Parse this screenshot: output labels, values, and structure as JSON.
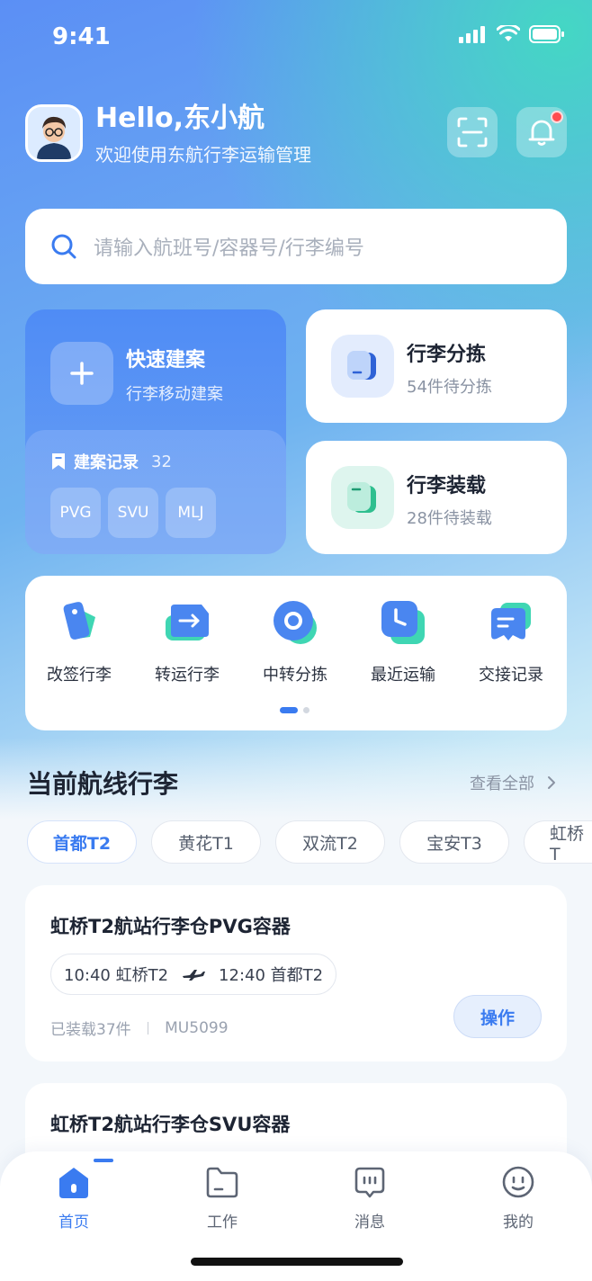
{
  "status_bar": {
    "time": "9:41"
  },
  "header": {
    "greeting": "Hello,东小航",
    "subtitle": "欢迎使用东航行李运输管理"
  },
  "search": {
    "placeholder": "请输入航班号/容器号/行李编号"
  },
  "quick_build": {
    "title": "快速建案",
    "subtitle": "行李移动建案",
    "records_label": "建案记录",
    "records_count": "32",
    "tags": [
      "PVG",
      "SVU",
      "MLJ"
    ]
  },
  "sorting_card": {
    "title": "行李分拣",
    "subtitle": "54件待分拣"
  },
  "loading_card": {
    "title": "行李装载",
    "subtitle": "28件待装载"
  },
  "shortcuts": [
    {
      "label": "改签行李",
      "icon": "tag-icon"
    },
    {
      "label": "转运行李",
      "icon": "transfer-icon"
    },
    {
      "label": "中转分拣",
      "icon": "transit-sort-icon"
    },
    {
      "label": "最近运输",
      "icon": "clock-icon"
    },
    {
      "label": "交接记录",
      "icon": "handover-icon"
    }
  ],
  "routes_section": {
    "title": "当前航线行李",
    "see_all": "查看全部",
    "chips": [
      "首都T2",
      "黄花T1",
      "双流T2",
      "宝安T3",
      "虹桥T"
    ]
  },
  "route_cards": [
    {
      "title": "虹桥T2航站行李仓PVG容器",
      "departure": "10:40 虹桥T2",
      "arrival": "12:40 首都T2",
      "loaded": "已装载37件",
      "flight": "MU5099",
      "action": "操作"
    },
    {
      "title": "虹桥T2航站行李仓SVU容器"
    }
  ],
  "tabbar": [
    {
      "label": "首页",
      "active": true
    },
    {
      "label": "工作",
      "active": false
    },
    {
      "label": "消息",
      "active": false
    },
    {
      "label": "我的",
      "active": false
    }
  ],
  "colors": {
    "primary": "#3a7bf0",
    "accent_teal": "#44d7c4",
    "notification": "#ff4d4f"
  }
}
